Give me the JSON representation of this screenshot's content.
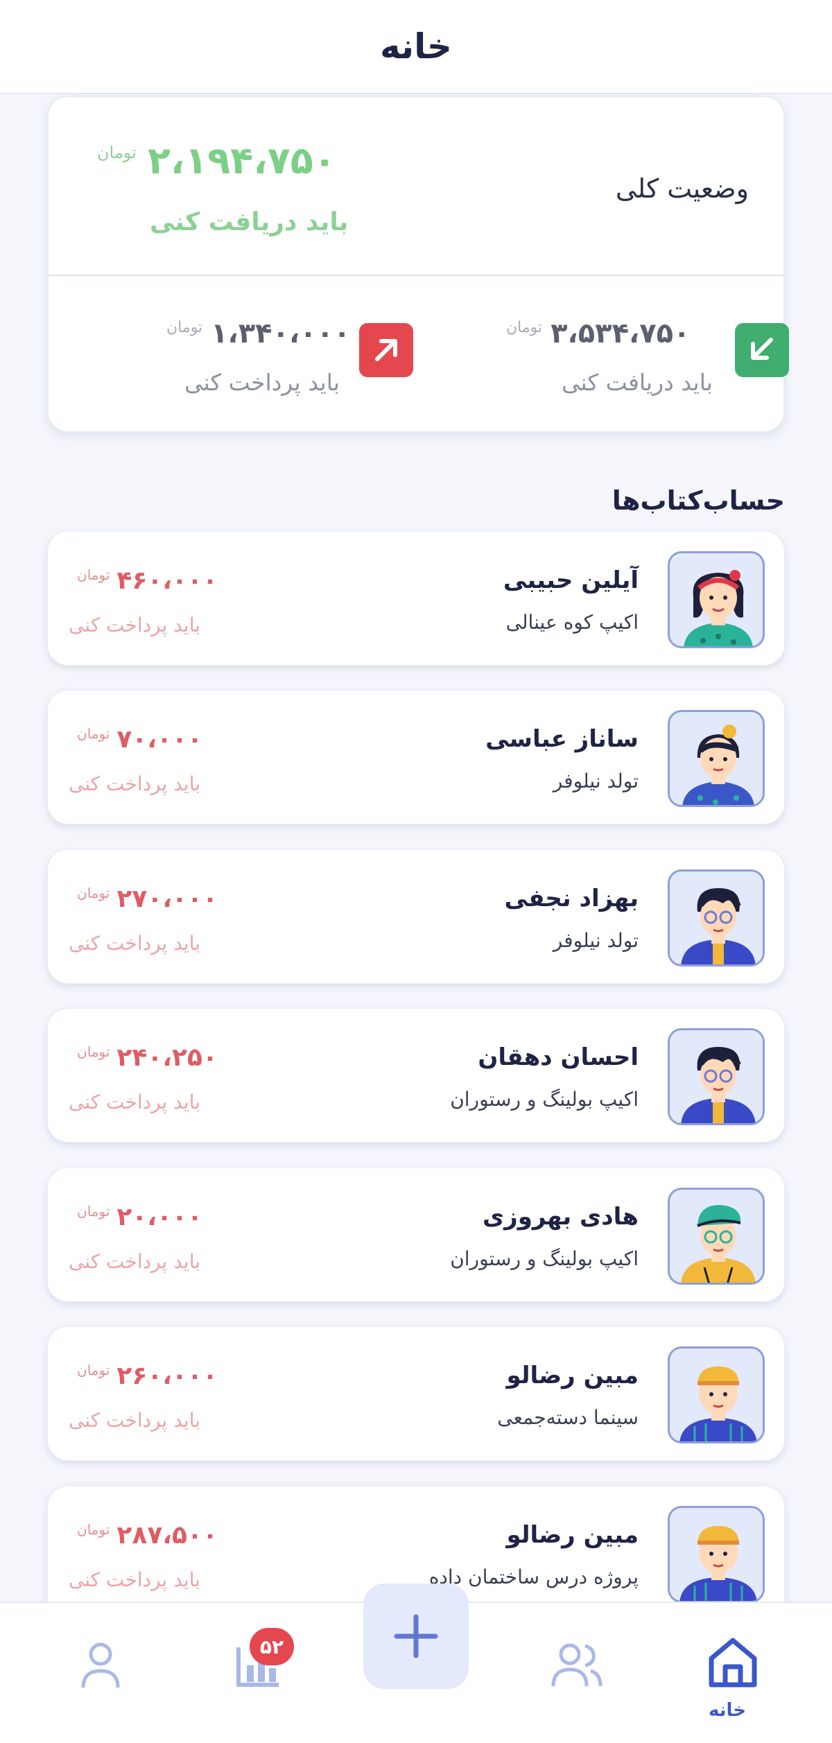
{
  "header": {
    "title": "خانه"
  },
  "summary": {
    "title": "وضعیت کلی",
    "total_amount": "۲،۱۹۴،۷۵۰",
    "currency": "تومان",
    "total_status": "باید دریافت کنی",
    "receive": {
      "amount": "۳،۵۳۴،۷۵۰",
      "currency": "تومان",
      "label": "باید دریافت کنی",
      "icon": "arrow-down-left-icon",
      "color": "#3fae6e"
    },
    "pay": {
      "amount": "۱،۳۴۰،۰۰۰",
      "currency": "تومان",
      "label": "باید پرداخت کنی",
      "icon": "arrow-up-right-icon",
      "color": "#e5474f"
    }
  },
  "accounts_section": {
    "title": "حساب‌کتاب‌ها"
  },
  "accounts": [
    {
      "name": "آیلین حبیبی",
      "event": "اکیپ کوه عینالی",
      "amount": "۴۶۰،۰۰۰",
      "currency": "تومان",
      "status": "باید پرداخت کنی"
    },
    {
      "name": "ساناز عباسی",
      "event": "تولد نیلوفر",
      "amount": "۷۰،۰۰۰",
      "currency": "تومان",
      "status": "باید پرداخت کنی"
    },
    {
      "name": "بهزاد نجفی",
      "event": "تولد نیلوفر",
      "amount": "۲۷۰،۰۰۰",
      "currency": "تومان",
      "status": "باید پرداخت کنی"
    },
    {
      "name": "احسان دهقان",
      "event": "اکیپ بولینگ و رستوران",
      "amount": "۲۴۰،۲۵۰",
      "currency": "تومان",
      "status": "باید پرداخت کنی"
    },
    {
      "name": "هادی بهروزی",
      "event": "اکیپ بولینگ و رستوران",
      "amount": "۲۰،۰۰۰",
      "currency": "تومان",
      "status": "باید پرداخت کنی"
    },
    {
      "name": "مبین رضالو",
      "event": "سینما دسته‌جمعی",
      "amount": "۲۶۰،۰۰۰",
      "currency": "تومان",
      "status": "باید پرداخت کنی"
    },
    {
      "name": "مبین رضالو",
      "event": "پروژه درس ساختمان داده",
      "amount": "۲۸۷،۵۰۰",
      "currency": "تومان",
      "status": "باید پرداخت کنی"
    }
  ],
  "nav": {
    "home_label": "خانه",
    "stats_badge": "۵۲",
    "items": [
      "home-icon",
      "groups-icon",
      "add-icon",
      "stats-icon",
      "profile-icon"
    ],
    "active_color": "#3a58c8",
    "inactive_color": "#a9b8e8"
  }
}
